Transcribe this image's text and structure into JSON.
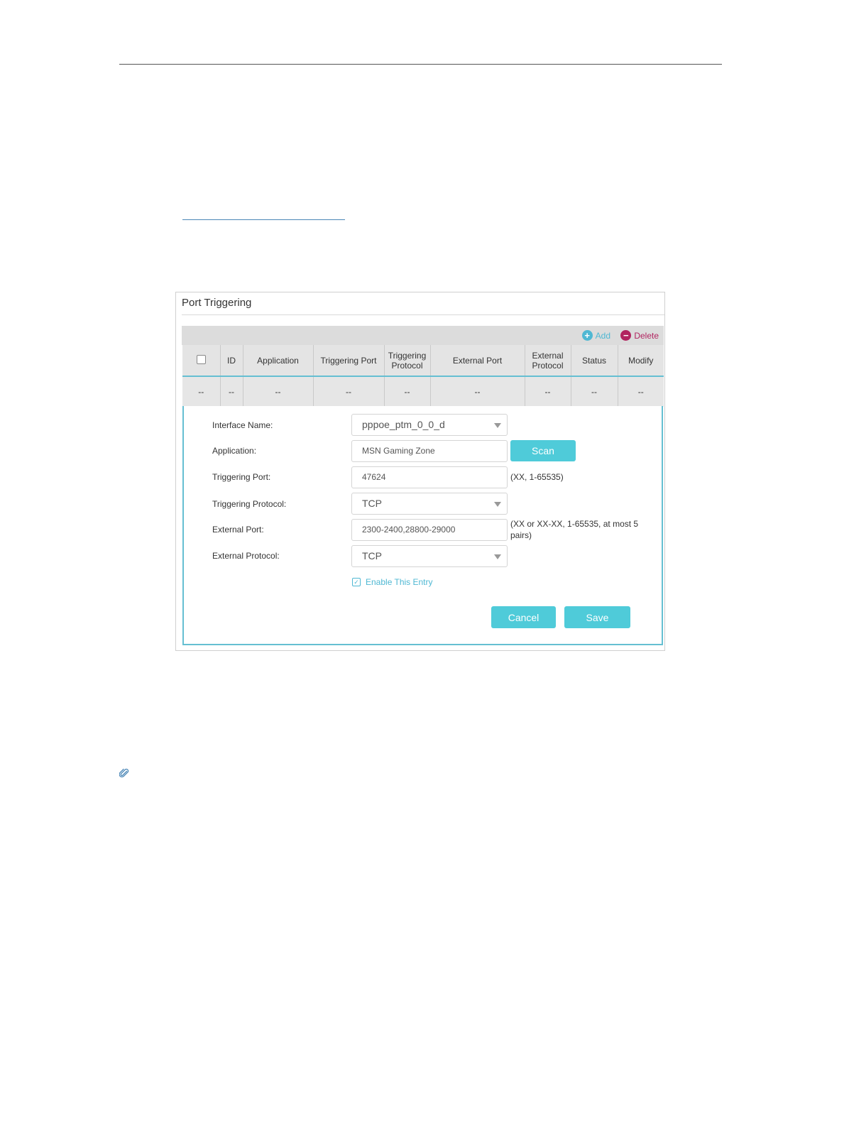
{
  "panel": {
    "title": "Port Triggering",
    "toolbar": {
      "add_label": "Add",
      "delete_label": "Delete"
    },
    "table": {
      "headers": [
        "ID",
        "Application",
        "Triggering Port",
        "Triggering Protocol",
        "External Port",
        "External Protocol",
        "Status",
        "Modify"
      ],
      "row": [
        "--",
        "--",
        "--",
        "--",
        "--",
        "--",
        "--",
        "--",
        "--"
      ]
    },
    "form": {
      "interface_name": {
        "label": "Interface Name:",
        "value": "pppoe_ptm_0_0_d"
      },
      "application": {
        "label": "Application:",
        "value": "MSN Gaming Zone",
        "scan_label": "Scan"
      },
      "triggering_port": {
        "label": "Triggering Port:",
        "value": "47624",
        "hint": "(XX, 1-65535)"
      },
      "triggering_protocol": {
        "label": "Triggering Protocol:",
        "value": "TCP"
      },
      "external_port": {
        "label": "External Port:",
        "value": "2300-2400,28800-29000",
        "hint": "(XX or XX-XX, 1-65535, at most 5 pairs)"
      },
      "external_protocol": {
        "label": "External Protocol:",
        "value": "TCP"
      },
      "enable_label": "Enable This Entry",
      "cancel_label": "Cancel",
      "save_label": "Save"
    }
  },
  "colors": {
    "accent": "#4fcbd9",
    "delete": "#b1245f",
    "link": "#4fb8d3"
  },
  "icons": [
    "plus-circle-icon",
    "minus-circle-icon",
    "chevron-down-icon",
    "checkbox-icon",
    "paperclip-icon"
  ]
}
